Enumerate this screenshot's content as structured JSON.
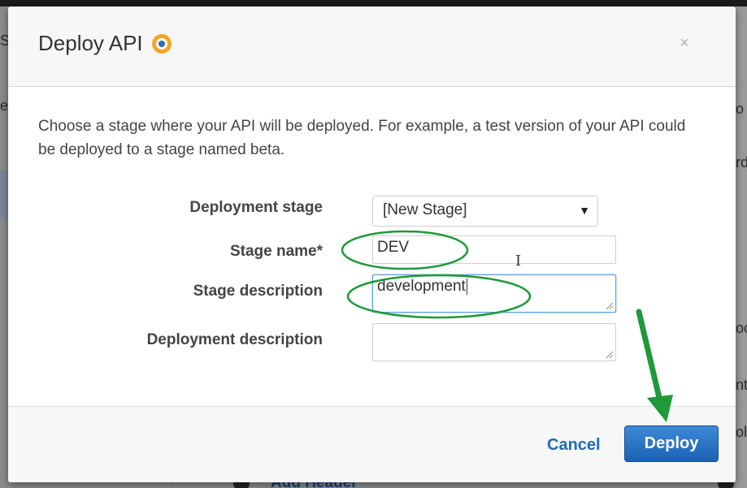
{
  "background": {
    "fragment_top_left": "S",
    "fragment_es": "es",
    "fragment_rd": "rd",
    "fragment_o": "o",
    "fragment_oo": "oo",
    "fragment_nt": "nt",
    "fragment_oli": "oli",
    "add_header_label": "Add Header"
  },
  "modal": {
    "title": "Deploy API",
    "close_glyph": "×",
    "intro": "Choose a stage where your API will be deployed. For example, a test version of your API could be deployed to a stage named beta.",
    "fields": {
      "deployment_stage": {
        "label": "Deployment stage",
        "selected": "[New Stage]",
        "arrow": "▼"
      },
      "stage_name": {
        "label": "Stage name*",
        "value": "DEV"
      },
      "stage_description": {
        "label": "Stage description",
        "value": "development"
      },
      "deployment_description": {
        "label": "Deployment description",
        "value": ""
      }
    },
    "footer": {
      "cancel_label": "Cancel",
      "deploy_label": "Deploy"
    }
  },
  "colors": {
    "primary_button": "#1b62b4",
    "link": "#1f6bb5",
    "annotation_green": "#1e9a3a",
    "title_badge": "#f5a623"
  },
  "icons": {
    "title_badge": "status-badge-icon",
    "close": "close-icon",
    "select_arrow": "chevron-down-icon",
    "text_cursor": "i-beam-cursor-icon",
    "annotation_arrow": "arrow-down-icon"
  }
}
